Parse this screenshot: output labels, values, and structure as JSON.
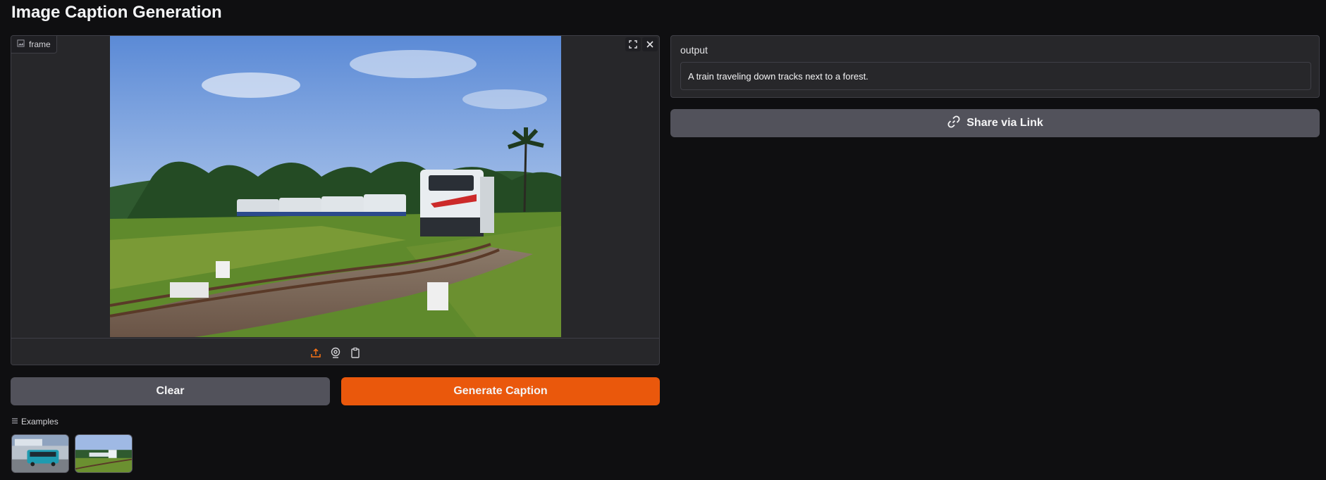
{
  "app": {
    "title": "Image Caption Generation"
  },
  "input_image": {
    "label": "frame",
    "label_icon": "image-icon",
    "actions": [
      {
        "name": "fullscreen-icon"
      },
      {
        "name": "close-icon"
      }
    ],
    "sources": [
      {
        "name": "upload-icon",
        "active": true
      },
      {
        "name": "webcam-icon",
        "active": false
      },
      {
        "name": "clipboard-icon",
        "active": false
      }
    ]
  },
  "buttons": {
    "clear_label": "Clear",
    "generate_label": "Generate Caption"
  },
  "examples": {
    "label": "Examples",
    "items": [
      {
        "name": "example-bus"
      },
      {
        "name": "example-train"
      }
    ]
  },
  "output": {
    "label": "output",
    "value": "A train traveling down tracks next to a forest."
  },
  "share": {
    "label": "Share via Link",
    "icon": "link-icon"
  },
  "colors": {
    "background": "#0f0f11",
    "panel": "#27272a",
    "primary": "#ea580c",
    "secondary": "#52525b"
  }
}
